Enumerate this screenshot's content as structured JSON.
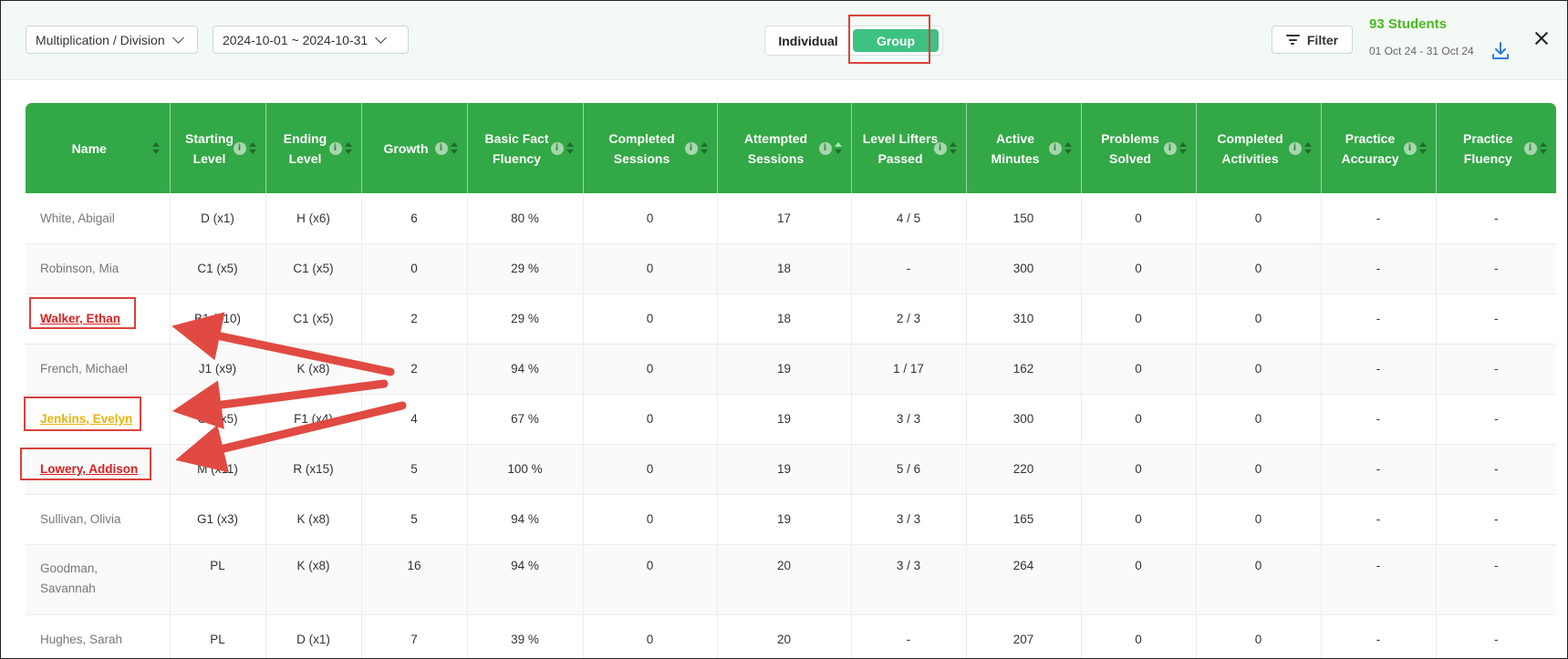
{
  "toolbar": {
    "operation_label": "Multiplication / Division",
    "date_label": "2024-10-01 ~ 2024-10-31",
    "view_individual": "Individual",
    "view_group": "Group",
    "filter_label": "Filter",
    "students_count": "93 Students",
    "date_range": "01 Oct 24 - 31 Oct 24"
  },
  "colors": {
    "header_green": "#33a846",
    "group_toggle": "#3ec283",
    "annotation_red": "#d9423c",
    "highlight_red_name": "#d82020",
    "highlight_yellow_name": "#e8b30f",
    "students_green": "#4cb91f"
  },
  "icons": [
    "chevron-down-icon",
    "filter-icon",
    "download-icon",
    "close-icon",
    "info-icon",
    "sort-icon"
  ],
  "table": {
    "headers": [
      {
        "label": "Name",
        "info": false
      },
      {
        "label": "Starting Level",
        "info": true
      },
      {
        "label": "Ending Level",
        "info": true
      },
      {
        "label": "Growth",
        "info": true
      },
      {
        "label": "Basic Fact Fluency",
        "info": true
      },
      {
        "label": "Completed Sessions",
        "info": true
      },
      {
        "label": "Attempted Sessions",
        "info": true,
        "sorted": "asc"
      },
      {
        "label": "Level Lifters Passed",
        "info": true
      },
      {
        "label": "Active Minutes",
        "info": true
      },
      {
        "label": "Problems Solved",
        "info": true
      },
      {
        "label": "Completed Activities",
        "info": true
      },
      {
        "label": "Practice Accuracy",
        "info": true
      },
      {
        "label": "Practice Fluency",
        "info": true
      }
    ],
    "rows": [
      {
        "name": "White, Abigail",
        "highlight": "",
        "cells": [
          "D (x1)",
          "H (x6)",
          "6",
          "80 %",
          "0",
          "17",
          "4 / 5",
          "150",
          "0",
          "0",
          "-",
          "-"
        ]
      },
      {
        "name": "Robinson, Mia",
        "highlight": "",
        "cells": [
          "C1 (x5)",
          "C1 (x5)",
          "0",
          "29 %",
          "0",
          "18",
          "-",
          "300",
          "0",
          "0",
          "-",
          "-"
        ]
      },
      {
        "name": "Walker, Ethan",
        "highlight": "red",
        "cells": [
          "B1 (x10)",
          "C1 (x5)",
          "2",
          "29 %",
          "0",
          "18",
          "2 / 3",
          "310",
          "0",
          "0",
          "-",
          "-"
        ]
      },
      {
        "name": "French, Michael",
        "highlight": "",
        "cells": [
          "J1 (x9)",
          "K (x8)",
          "2",
          "94 %",
          "0",
          "19",
          "1 / 17",
          "162",
          "0",
          "0",
          "-",
          "-"
        ]
      },
      {
        "name": "Jenkins, Evelyn",
        "highlight": "yellow",
        "cells": [
          "C1 (x5)",
          "F1 (x4)",
          "4",
          "67 %",
          "0",
          "19",
          "3 / 3",
          "300",
          "0",
          "0",
          "-",
          "-"
        ]
      },
      {
        "name": "Lowery, Addison",
        "highlight": "red",
        "cells": [
          "M (x11)",
          "R (x15)",
          "5",
          "100 %",
          "0",
          "19",
          "5 / 6",
          "220",
          "0",
          "0",
          "-",
          "-"
        ]
      },
      {
        "name": "Sullivan, Olivia",
        "highlight": "",
        "cells": [
          "G1 (x3)",
          "K (x8)",
          "5",
          "94 %",
          "0",
          "19",
          "3 / 3",
          "165",
          "0",
          "0",
          "-",
          "-"
        ]
      },
      {
        "name": "Goodman, Savannah",
        "highlight": "",
        "cells": [
          "PL",
          "K (x8)",
          "16",
          "94 %",
          "0",
          "20",
          "3 / 3",
          "264",
          "0",
          "0",
          "-",
          "-"
        ]
      },
      {
        "name": "Hughes, Sarah",
        "highlight": "",
        "cells": [
          "PL",
          "D (x1)",
          "7",
          "39 %",
          "0",
          "20",
          "-",
          "207",
          "0",
          "0",
          "-",
          "-"
        ]
      }
    ]
  }
}
